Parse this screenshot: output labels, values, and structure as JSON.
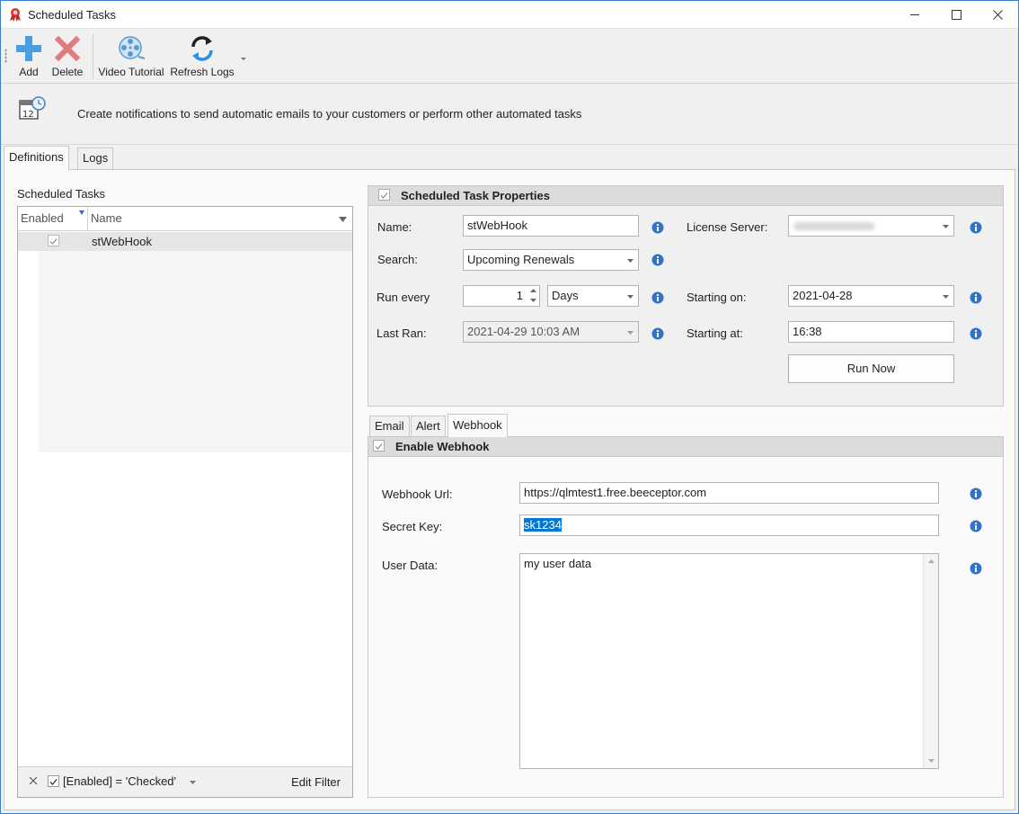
{
  "window": {
    "title": "Scheduled Tasks",
    "icon": "ribbon-icon",
    "accent": "#3b7fd4"
  },
  "toolbar": {
    "add_label": "Add",
    "delete_label": "Delete",
    "video_label": "Video Tutorial",
    "refresh_label": "Refresh Logs"
  },
  "banner": {
    "text": "Create notifications to send automatic emails to your customers or perform other automated tasks"
  },
  "tabs": [
    {
      "label": "Definitions",
      "active": true
    },
    {
      "label": "Logs",
      "active": false
    }
  ],
  "left_panel": {
    "title": "Scheduled Tasks",
    "columns": [
      "Enabled",
      "Name"
    ],
    "rows": [
      {
        "enabled": true,
        "name": "stWebHook"
      }
    ],
    "filter_text": "[Enabled] = 'Checked'",
    "edit_filter_label": "Edit Filter"
  },
  "properties": {
    "title": "Scheduled Task Properties",
    "name_label": "Name:",
    "name_value": "stWebHook",
    "search_label": "Search:",
    "search_value": "Upcoming Renewals",
    "run_every_label": "Run every",
    "run_every_value": "1",
    "run_every_unit": "Days",
    "last_ran_label": "Last Ran:",
    "last_ran_value": "2021-04-29 10:03 AM",
    "license_server_label": "License Server:",
    "license_server_value": "",
    "starting_on_label": "Starting on:",
    "starting_on_value": "2021-04-28",
    "starting_at_label": "Starting at:",
    "starting_at_value": "16:38",
    "run_now_label": "Run Now"
  },
  "inner_tabs": [
    {
      "label": "Email",
      "active": false
    },
    {
      "label": "Alert",
      "active": false
    },
    {
      "label": "Webhook",
      "active": true
    }
  ],
  "webhook": {
    "enable_label": "Enable Webhook",
    "url_label": "Webhook Url:",
    "url_value": "https://qlmtest1.free.beeceptor.com",
    "secret_label": "Secret Key:",
    "secret_value": "sk1234",
    "user_data_label": "User Data:",
    "user_data_value": "my user data"
  }
}
